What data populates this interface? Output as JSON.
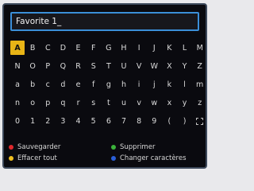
{
  "input": {
    "value": "Favorite 1_"
  },
  "keyboard": {
    "rows": [
      [
        "A",
        "B",
        "C",
        "D",
        "E",
        "F",
        "G",
        "H",
        "I",
        "J",
        "K",
        "L",
        "M"
      ],
      [
        "N",
        "O",
        "P",
        "Q",
        "R",
        "S",
        "T",
        "U",
        "V",
        "W",
        "X",
        "Y",
        "Z"
      ],
      [
        "a",
        "b",
        "c",
        "d",
        "e",
        "f",
        "g",
        "h",
        "i",
        "j",
        "k",
        "l",
        "m"
      ],
      [
        "n",
        "o",
        "p",
        "q",
        "r",
        "s",
        "t",
        "u",
        "v",
        "w",
        "x",
        "y",
        "z"
      ],
      [
        "0",
        "1",
        "2",
        "3",
        "4",
        "5",
        "6",
        "7",
        "8",
        "9",
        "(",
        ")",
        "space"
      ]
    ],
    "selected": "A"
  },
  "legend": [
    {
      "color_name": "red",
      "color": "#e0282c",
      "label": "Sauvegarder"
    },
    {
      "color_name": "green",
      "color": "#3bb23b",
      "label": "Supprimer"
    },
    {
      "color_name": "yellow",
      "color": "#f0c020",
      "label": "Effacer tout"
    },
    {
      "color_name": "blue",
      "color": "#2a5fd8",
      "label": "Changer caractères"
    }
  ]
}
